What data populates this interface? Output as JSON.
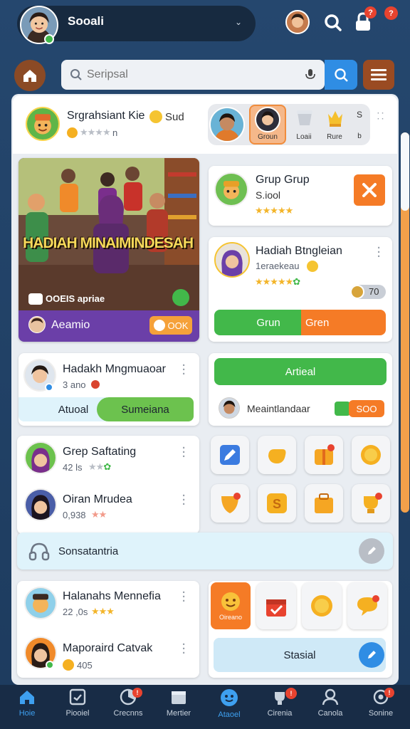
{
  "topbar": {
    "title": "Sooali",
    "badges": [
      "?",
      "?"
    ]
  },
  "search": {
    "placeholder": "Seripsal"
  },
  "header": {
    "name": "Srgrahsiant Kie",
    "suffix": "Sud",
    "rating_text": "n",
    "tabs": [
      {
        "label": "",
        "active": false
      },
      {
        "label": "Groun",
        "active": true
      },
      {
        "label": "Loaii",
        "active": false
      },
      {
        "label": "Rure",
        "active": false
      },
      {
        "label": "S",
        "active": false
      }
    ]
  },
  "feature": {
    "banner": "HADIAH MINAIMINDESAH",
    "caption": "OOEIS apriae",
    "footer_name": "Aeamio",
    "footer_btn": "OOK"
  },
  "grup_card": {
    "name": "Grup Grup",
    "sub": "S.iool"
  },
  "hadiah_card": {
    "name": "Hadiah Btngleian",
    "sub": "1eraekeau",
    "count": "70",
    "btn_left": "Grun",
    "btn_right": "Gren"
  },
  "hadakh_card": {
    "name": "Hadakh Mngmuaoar",
    "sub": "3 ano",
    "tab_left": "Atuoal",
    "tab_right": "Sumeiana"
  },
  "artieal_card": {
    "btn": "Artieal",
    "name": "Meaintlandaar",
    "chip": "SOO"
  },
  "list1": [
    {
      "name": "Grep Saftating",
      "sub": "42 ls"
    },
    {
      "name": "Oiran Mrudea",
      "sub": "0,938"
    }
  ],
  "search2": {
    "label": "Sonsatantria"
  },
  "list2": [
    {
      "name": "Halanahs Mennefia",
      "sub": "22 ,0s"
    },
    {
      "name": "Maporaird Catvak",
      "sub": "405"
    }
  ],
  "rewards": {
    "first_label": "Oireano",
    "cta": "Stasial"
  },
  "nav": [
    {
      "label": "Hoie",
      "icon": "home-icon",
      "active": true
    },
    {
      "label": "Piooiel",
      "icon": "document-icon",
      "active": false
    },
    {
      "label": "Crecnns",
      "icon": "chart-icon",
      "active": false
    },
    {
      "label": "Mertier",
      "icon": "calendar-icon",
      "active": false
    },
    {
      "label": "Ataoel",
      "icon": "compass-icon",
      "active": false
    },
    {
      "label": "Cirenia",
      "icon": "trophy-icon",
      "active": false
    },
    {
      "label": "Canola",
      "icon": "person-icon",
      "active": false
    },
    {
      "label": "Sonine",
      "icon": "settings-icon",
      "active": false
    }
  ],
  "colors": {
    "accent_blue": "#2f8de4",
    "accent_orange": "#f57b26",
    "accent_green": "#42b84a",
    "purple": "#6b3fa8",
    "gold": "#f3b52a"
  }
}
